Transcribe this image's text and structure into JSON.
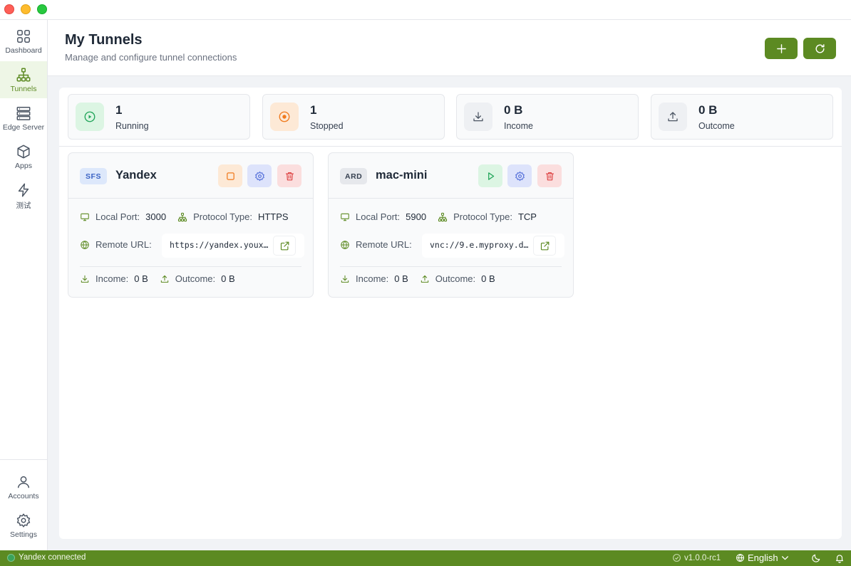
{
  "colors": {
    "accent": "#5c8a22",
    "running": "#22a55a",
    "stopped": "#f07a1e",
    "danger": "#dc3f3f",
    "settings": "#4f6bd8"
  },
  "sidebar": {
    "items": [
      {
        "label": "Dashboard",
        "icon": "grid-icon"
      },
      {
        "label": "Tunnels",
        "icon": "network-icon",
        "active": true
      },
      {
        "label": "Edge Server",
        "icon": "server-icon"
      },
      {
        "label": "Apps",
        "icon": "cube-icon"
      },
      {
        "label": "测试",
        "icon": "bolt-icon"
      }
    ],
    "bottom": [
      {
        "label": "Accounts",
        "icon": "user-icon"
      },
      {
        "label": "Settings",
        "icon": "gear-icon"
      }
    ]
  },
  "header": {
    "title": "My Tunnels",
    "subtitle": "Manage and configure tunnel connections",
    "add_icon": "plus-icon",
    "refresh_icon": "refresh-icon"
  },
  "stats": [
    {
      "value": "1",
      "label": "Running",
      "icon": "play-circle-icon"
    },
    {
      "value": "1",
      "label": "Stopped",
      "icon": "stop-circle-icon"
    },
    {
      "value": "0 B",
      "label": "Income",
      "icon": "download-icon"
    },
    {
      "value": "0 B",
      "label": "Outcome",
      "icon": "upload-icon"
    }
  ],
  "tunnels": [
    {
      "badge": "SFS",
      "name": "Yandex",
      "status": "running",
      "local_port_label": "Local Port:",
      "local_port": "3000",
      "protocol_label": "Protocol Type:",
      "protocol": "HTTPS",
      "remote_url_label": "Remote URL:",
      "remote_url": "https://yandex.youx…",
      "income_label": "Income:",
      "income": "0 B",
      "outcome_label": "Outcome:",
      "outcome": "0 B"
    },
    {
      "badge": "ARD",
      "name": "mac-mini",
      "status": "stopped",
      "local_port_label": "Local Port:",
      "local_port": "5900",
      "protocol_label": "Protocol Type:",
      "protocol": "TCP",
      "remote_url_label": "Remote URL:",
      "remote_url": "vnc://9.e.myproxy.d…",
      "income_label": "Income:",
      "income": "0 B",
      "outcome_label": "Outcome:",
      "outcome": "0 B"
    }
  ],
  "statusbar": {
    "connection": "Yandex connected",
    "version": "v1.0.0-rc1",
    "language": "English"
  }
}
